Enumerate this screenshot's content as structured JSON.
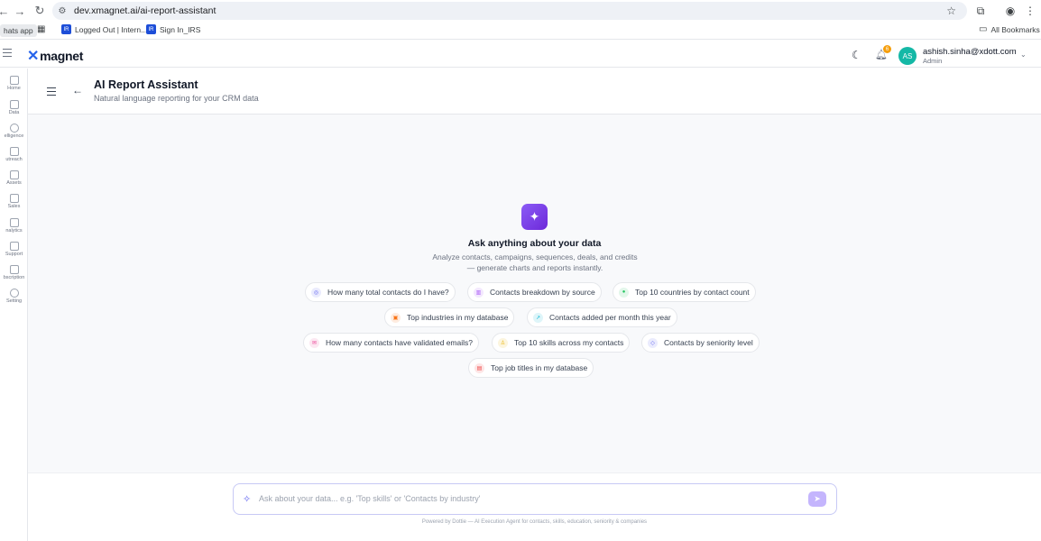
{
  "browser": {
    "url": "dev.xmagnet.ai/ai-report-assistant",
    "bookmarks": [
      {
        "label": "hats app"
      },
      {
        "label": "Logged Out | Intern..."
      },
      {
        "label": "Sign In_IRS"
      }
    ],
    "all_bookmarks": "All Bookmarks"
  },
  "app": {
    "logo": "magnet",
    "notifications_count": "6",
    "user": {
      "initials": "AS",
      "email": "ashish.sinha@xdott.com",
      "role": "Admin"
    }
  },
  "sidebar": {
    "items": [
      {
        "label": "Home"
      },
      {
        "label": "Data"
      },
      {
        "label": "elligence"
      },
      {
        "label": "utreach"
      },
      {
        "label": "Assets"
      },
      {
        "label": "Sales"
      },
      {
        "label": "nalytics"
      },
      {
        "label": "Support"
      },
      {
        "label": "bscription"
      },
      {
        "label": "Setting"
      }
    ]
  },
  "page": {
    "title": "AI Report Assistant",
    "subtitle": "Natural language reporting for your CRM data"
  },
  "hero": {
    "title": "Ask anything about your data",
    "description": "Analyze contacts, campaigns, sequences, deals, and credits — generate charts and reports instantly."
  },
  "suggestions": [
    {
      "label": "How many total contacts do I have?",
      "icon": "users-icon",
      "color": "#6366f1"
    },
    {
      "label": "Contacts breakdown by source",
      "icon": "bar-chart-icon",
      "color": "#a855f7"
    },
    {
      "label": "Top 10 countries by contact count",
      "icon": "globe-icon",
      "color": "#22c55e"
    },
    {
      "label": "Top industries in my database",
      "icon": "building-icon",
      "color": "#f97316"
    },
    {
      "label": "Contacts added per month this year",
      "icon": "trend-icon",
      "color": "#06b6d4"
    },
    {
      "label": "How many contacts have validated emails?",
      "icon": "mail-icon",
      "color": "#ec4899"
    },
    {
      "label": "Top 10 skills across my contacts",
      "icon": "award-icon",
      "color": "#eab308"
    },
    {
      "label": "Contacts by seniority level",
      "icon": "graduation-icon",
      "color": "#6366f1"
    },
    {
      "label": "Top job titles in my database",
      "icon": "briefcase-icon",
      "color": "#ef4444"
    }
  ],
  "chat": {
    "placeholder": "Ask about your data... e.g. 'Top skills' or 'Contacts by industry'",
    "powered_by": "Powered by Dottie — AI Execution Agent for contacts, skills, education, seniority & companies"
  }
}
